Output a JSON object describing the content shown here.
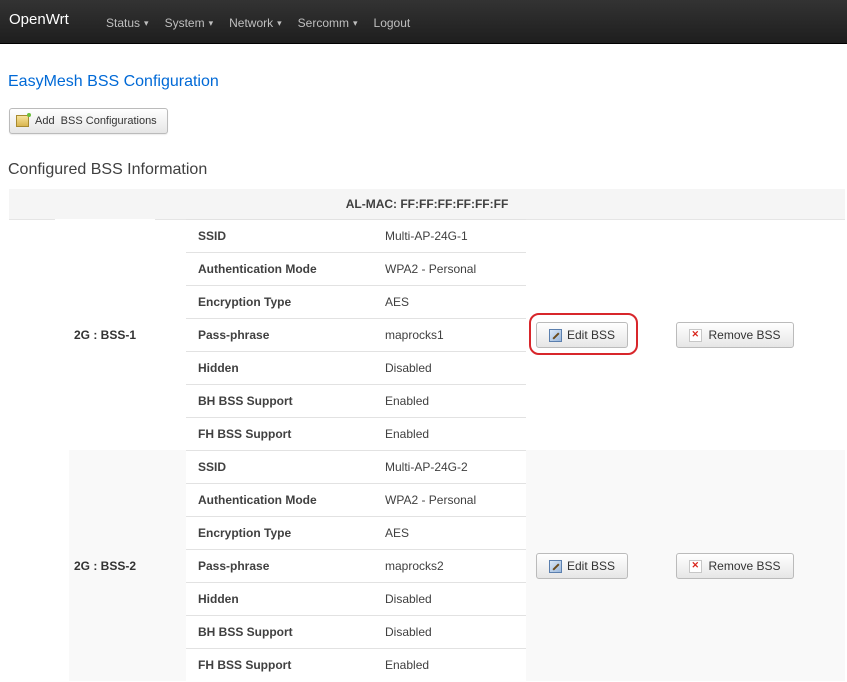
{
  "navbar": {
    "brand": "OpenWrt",
    "menu": [
      {
        "label": "Status",
        "has_caret": true
      },
      {
        "label": "System",
        "has_caret": true
      },
      {
        "label": "Network",
        "has_caret": true
      },
      {
        "label": "Sercomm",
        "has_caret": true
      },
      {
        "label": "Logout",
        "has_caret": false
      }
    ]
  },
  "page": {
    "title": "EasyMesh BSS Configuration",
    "add_button": "Add  BSS Configurations",
    "section_title": "Configured BSS Information",
    "al_mac": "AL-MAC: FF:FF:FF:FF:FF:FF"
  },
  "bss": [
    {
      "label": "2G : BSS-1",
      "edit_label": "Edit BSS",
      "remove_label": "Remove BSS",
      "highlighted_edit": true,
      "fields": [
        {
          "key": "SSID",
          "value": "Multi-AP-24G-1"
        },
        {
          "key": "Authentication Mode",
          "value": "WPA2 - Personal"
        },
        {
          "key": "Encryption Type",
          "value": "AES"
        },
        {
          "key": "Pass-phrase",
          "value": "maprocks1"
        },
        {
          "key": "Hidden",
          "value": "Disabled"
        },
        {
          "key": "BH BSS Support",
          "value": "Enabled"
        },
        {
          "key": "FH BSS Support",
          "value": "Enabled"
        }
      ]
    },
    {
      "label": "2G : BSS-2",
      "edit_label": "Edit BSS",
      "remove_label": "Remove BSS",
      "highlighted_edit": false,
      "fields": [
        {
          "key": "SSID",
          "value": "Multi-AP-24G-2"
        },
        {
          "key": "Authentication Mode",
          "value": "WPA2 - Personal"
        },
        {
          "key": "Encryption Type",
          "value": "AES"
        },
        {
          "key": "Pass-phrase",
          "value": "maprocks2"
        },
        {
          "key": "Hidden",
          "value": "Disabled"
        },
        {
          "key": "BH BSS Support",
          "value": "Disabled"
        },
        {
          "key": "FH BSS Support",
          "value": "Enabled"
        }
      ]
    }
  ],
  "icons": {
    "add": "add-config-icon",
    "edit": "edit-icon",
    "remove": "remove-icon",
    "caret": "chevron-down-icon"
  },
  "colors": {
    "title_link": "#0069d6",
    "highlight": "#d8262b",
    "navbar": "#222222"
  }
}
